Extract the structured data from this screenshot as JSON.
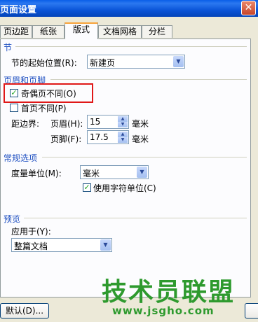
{
  "window": {
    "title": "页面设置",
    "close_icon": "close-icon"
  },
  "tabs": [
    {
      "label": "页边距"
    },
    {
      "label": "纸张"
    },
    {
      "label": "版式",
      "active": true
    },
    {
      "label": "文档网格"
    },
    {
      "label": "分栏"
    }
  ],
  "section": {
    "group": "节",
    "start_label": "节的起始位置(R):",
    "start_value": "新建页"
  },
  "header_footer": {
    "group": "页眉和页脚",
    "odd_even_label": "奇偶页不同(O)",
    "odd_even_checked": true,
    "first_page_label": "首页不同(P)",
    "first_page_checked": false,
    "from_edge_label": "距边界:",
    "header_label": "页眉(H):",
    "header_value": "15",
    "footer_label": "页脚(F):",
    "footer_value": "17.5",
    "unit": "毫米"
  },
  "general": {
    "group": "常规选项",
    "measure_label": "度量单位(M):",
    "measure_value": "毫米",
    "char_units_label": "使用字符单位(C)",
    "char_units_checked": true
  },
  "preview": {
    "group": "预览",
    "apply_label": "应用于(Y):",
    "apply_value": "整篇文档"
  },
  "footer": {
    "default_label": "默认(D)..."
  },
  "watermark": {
    "brand": "技术员联盟",
    "url": "www.jsgho.com"
  },
  "colors": {
    "highlight": "#e01818",
    "group_text": "#1e4fc1",
    "watermark": "#2e9a2e"
  }
}
